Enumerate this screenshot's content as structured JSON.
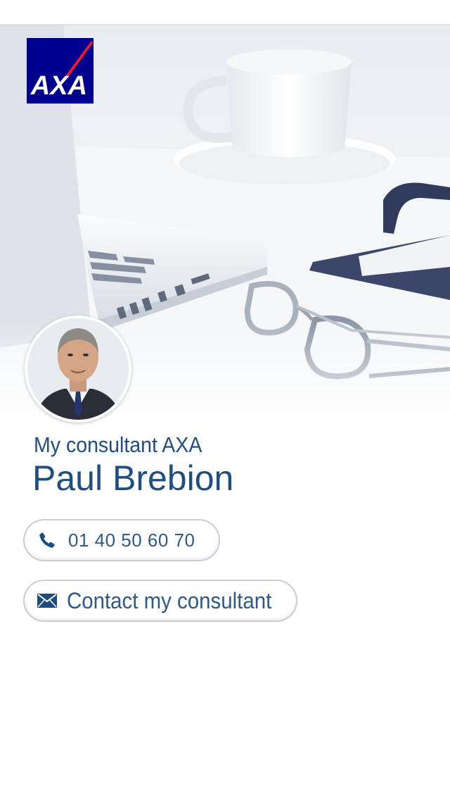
{
  "header": {
    "logo_text": "AXA"
  },
  "consultant": {
    "subtitle": "My consultant AXA",
    "name": "Paul Brebion"
  },
  "actions": {
    "phone_label": "01 40 50 60 70",
    "contact_label": "Contact my consultant"
  },
  "colors": {
    "brand_blue": "#00008f",
    "brand_red": "#ff1721",
    "text_blue": "#1f4f82"
  },
  "icons": {
    "phone": "phone-icon",
    "envelope": "envelope-icon"
  }
}
